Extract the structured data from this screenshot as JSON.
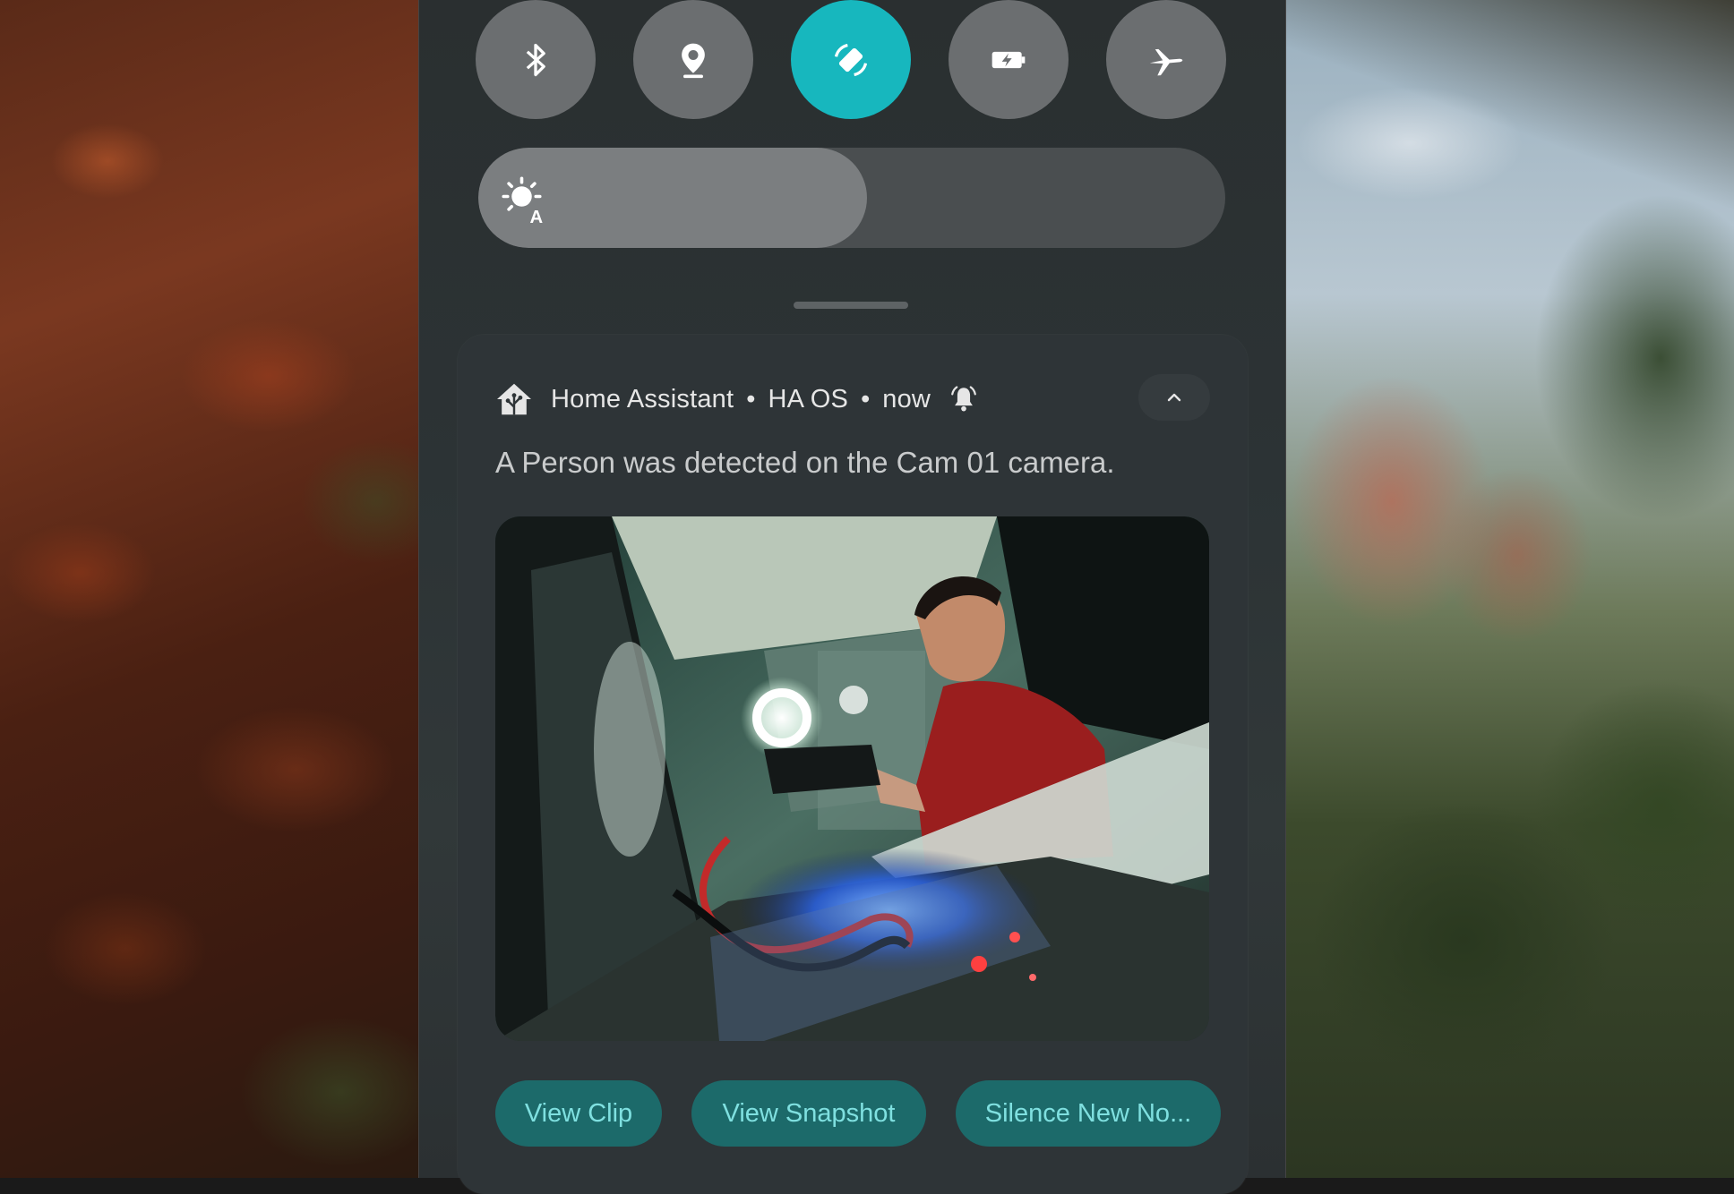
{
  "quick_settings": {
    "tiles": [
      {
        "name": "bluetooth",
        "icon": "bluetooth-icon",
        "active": false
      },
      {
        "name": "location",
        "icon": "location-pin-icon",
        "active": false
      },
      {
        "name": "auto-rotate",
        "icon": "rotate-icon",
        "active": true
      },
      {
        "name": "battery-saver",
        "icon": "battery-saver-icon",
        "active": false
      },
      {
        "name": "airplane-mode",
        "icon": "airplane-icon",
        "active": false
      }
    ],
    "brightness": {
      "icon": "auto-brightness-icon",
      "level_fraction": 0.52
    },
    "colors": {
      "active_tile": "#17b7be",
      "inactive_tile": "#6b6e70"
    }
  },
  "notification": {
    "app_name": "Home Assistant",
    "sub_text": "HA OS",
    "time": "now",
    "separator": "•",
    "message": "A Person was detected on the Cam 01 camera.",
    "image_alt": "camera snapshot",
    "actions": [
      "View Clip",
      "View Snapshot",
      "Silence New No..."
    ],
    "accent": "#1c6a6a"
  }
}
